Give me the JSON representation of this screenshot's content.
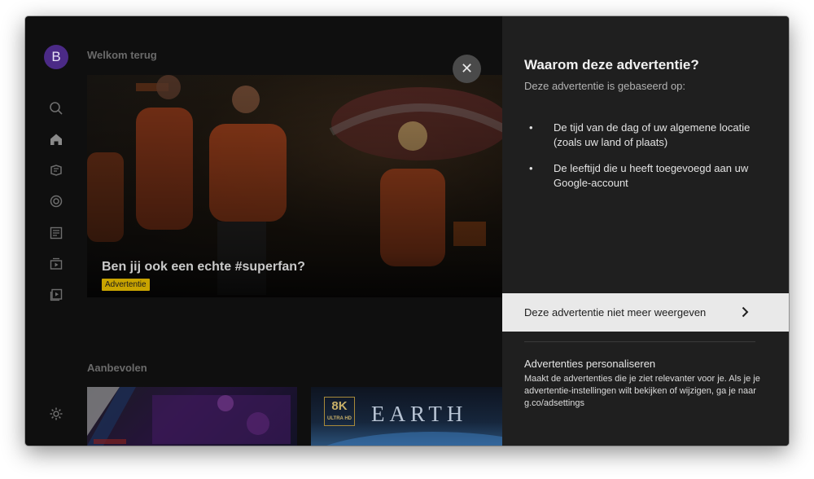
{
  "sidebar": {
    "avatar_initial": "B",
    "items": [
      "search-icon",
      "home-icon",
      "explore-icon",
      "subscriptions-icon",
      "library-icon",
      "channels-icon",
      "playlist-icon"
    ],
    "settings_icon": "gear-icon"
  },
  "main": {
    "greeting": "Welkom terug",
    "hero": {
      "title": "Ben jij ook een echte #superfan?",
      "badge": "Advertentie"
    },
    "recommended_title": "Aanbevolen",
    "thumbs": [
      {
        "badge_big": "8K",
        "badge_small": "ULTRA HD",
        "title": "EARTH"
      }
    ]
  },
  "close_button": {
    "icon": "close-icon",
    "glyph": "✕"
  },
  "panel": {
    "title": "Waarom deze advertentie?",
    "subtitle": "Deze advertentie is gebaseerd op:",
    "reasons": [
      "De tijd van de dag of uw algemene locatie (zoals uw land of plaats)",
      "De leeftijd die u heeft toegevoegd aan uw Google-account"
    ],
    "hide_ad_label": "Deze advertentie niet meer weergeven",
    "personalize_title": "Advertenties personaliseren",
    "personalize_desc": "Maakt de advertenties die je ziet relevanter voor je. Als je je advertentie-instellingen wilt bekijken of wijzigen, ga je naar g.co/adsettings"
  },
  "colors": {
    "background": "#0f0f0f",
    "panel": "#1f1f1f",
    "highlight_row": "#e9e9e9",
    "badge": "#c9a400",
    "avatar": "#4b2a86"
  }
}
